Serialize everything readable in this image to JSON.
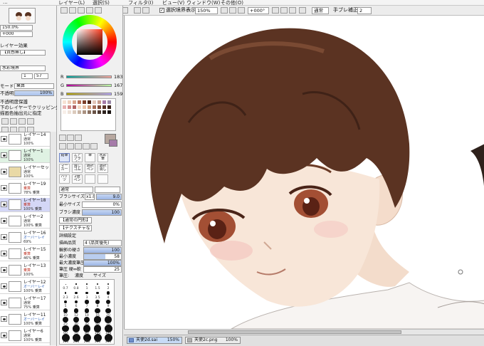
{
  "menubar": {
    "items": [
      "...",
      "レイヤー(L)",
      "選択(S)",
      "フィルタ(I)",
      "ビュー(V)",
      "ウィンドウ(W)",
      "その他(O)"
    ]
  },
  "toolbar": {
    "stabilize_label": "選択境界表示",
    "zoom": "150%",
    "angle": "+000°",
    "blend": "通常",
    "shake_label": "手ブレ補正",
    "shake_value": "2"
  },
  "navigator": {
    "zoom": "150.0%",
    "angle": "+000"
  },
  "layer_props": {
    "header": "レイヤー効果",
    "texture_label": "用紙質感",
    "texture_value": "【質感無し】",
    "effect_label": "水彩境界",
    "effect_value": "水彩境界",
    "width": "1",
    "strength": "57",
    "mode_label": "モード",
    "mode_value": "乗算",
    "opacity_label": "不透明度",
    "opacity_value": "100%",
    "opt1": "不透明度保護",
    "opt2": "下のレイヤーでクリッピング",
    "opt3": "描画色抽出元に指定"
  },
  "layers": [
    {
      "name": "レイヤー14",
      "mode": "通常",
      "opacity": "100%",
      "style": "normal"
    },
    {
      "name": "レイヤー1",
      "mode": "通常",
      "opacity": "100%",
      "style": "green"
    },
    {
      "name": "レイヤーセット1",
      "mode": "通常",
      "opacity": "100%",
      "style": "folder"
    },
    {
      "name": "レイヤー19",
      "mode": "乗算",
      "opacity": "78% 乗算",
      "style": "normal"
    },
    {
      "name": "レイヤー18",
      "mode": "乗算",
      "opacity": "100% 乗算",
      "style": "sel"
    },
    {
      "name": "レイヤー2",
      "mode": "通常",
      "opacity": "100% 乗算",
      "style": "normal"
    },
    {
      "name": "レイヤー16",
      "mode": "オーバーレイ",
      "opacity": "69%",
      "style": "normal"
    },
    {
      "name": "レイヤー15",
      "mode": "乗算",
      "opacity": "46% 乗算",
      "style": "normal"
    },
    {
      "name": "レイヤー13",
      "mode": "乗算",
      "opacity": "100%",
      "style": "normal"
    },
    {
      "name": "レイヤー12",
      "mode": "オーバーレイ",
      "opacity": "100% 乗算",
      "style": "normal"
    },
    {
      "name": "レイヤー17",
      "mode": "通常",
      "opacity": "75% 乗算",
      "style": "normal"
    },
    {
      "name": "レイヤー11",
      "mode": "オーバーレイ",
      "opacity": "100% 乗算",
      "style": "normal"
    },
    {
      "name": "レイヤー6",
      "mode": "通常",
      "opacity": "100% 乗算",
      "style": "normal"
    }
  ],
  "color": {
    "r_label": "R",
    "r": "183",
    "g_label": "G",
    "g": "167",
    "b_label": "B",
    "b": "159",
    "current": "#b7a79f"
  },
  "tools": {
    "row1": [
      "鉛筆",
      "エアブラシ",
      "筆",
      "水彩筆"
    ],
    "row2": [
      "マーカー",
      "消しゴム",
      "選択ペン",
      "選択消し"
    ],
    "row3": [
      "バケツ",
      "2値ペン",
      "",
      ""
    ]
  },
  "brush": {
    "mode": "通常",
    "size_label": "ブラシサイズ",
    "size_mult": "x1.0",
    "size_value": "9.0",
    "min_size_label": "最小サイズ",
    "min_size_value": "0%",
    "density_label": "ブラシ濃度",
    "density_value": "100",
    "shape": "【通常の円形】",
    "texture": "【テクスチャなし】",
    "detail_label": "詳細設定",
    "quality_label": "描画品質",
    "quality_value": "4 (品質優先)",
    "edge_label": "輪郭の硬さ",
    "edge_value": "100",
    "min_density_label": "最小濃度",
    "min_density_value": "58",
    "max_pressure_label": "最大濃度筆圧",
    "max_pressure_value": "100%",
    "pressure_label": "筆圧 硬⇔軟",
    "pressure_value": "25",
    "pressure2_label": "筆圧:",
    "pressure2_a": "濃度",
    "pressure2_b": "サイズ",
    "sizes": [
      "0.7",
      "0.8",
      "1",
      "1.5",
      "2",
      "2.3",
      "2.6",
      "3",
      "3.5",
      "4",
      "5",
      "6",
      "7",
      "8",
      "9",
      "10",
      "12",
      "14",
      "16",
      "20",
      "25",
      "30",
      "35",
      "40",
      "50",
      "60",
      "70",
      "80",
      "100",
      "120",
      "160",
      "200",
      "250",
      "300",
      "350"
    ]
  },
  "files": [
    {
      "name": "天使2d.sai",
      "zoom": "150%",
      "active": true
    },
    {
      "name": "天使2c.png",
      "zoom": "100%",
      "active": false
    }
  ]
}
